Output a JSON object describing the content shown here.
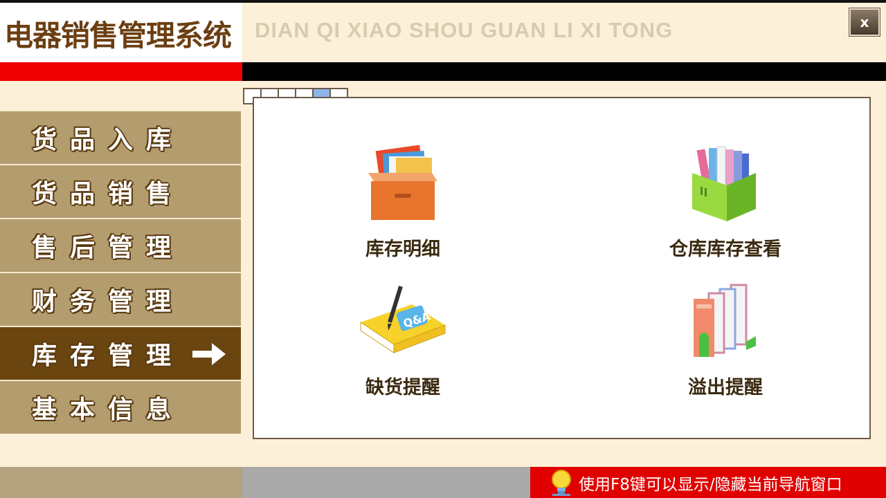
{
  "header": {
    "title": "电器销售管理系统",
    "pinyin": "DIAN QI XIAO SHOU GUAN LI XI TONG",
    "close_label": "x"
  },
  "sidebar": {
    "items": [
      {
        "label": "货品入库",
        "active": false
      },
      {
        "label": "货品销售",
        "active": false
      },
      {
        "label": "售后管理",
        "active": false
      },
      {
        "label": "财务管理",
        "active": false
      },
      {
        "label": "库存管理",
        "active": true
      },
      {
        "label": "基本信息",
        "active": false
      }
    ]
  },
  "pager": {
    "count": 6,
    "active_index": 4
  },
  "tiles": [
    {
      "label": "库存明细",
      "icon": "file-box-icon"
    },
    {
      "label": "仓库库存查看",
      "icon": "book-stand-icon"
    },
    {
      "label": "缺货提醒",
      "icon": "notebook-pen-icon"
    },
    {
      "label": "溢出提醒",
      "icon": "books-icon"
    }
  ],
  "status": {
    "hint": "使用F8键可以显示/隐藏当前导航窗口",
    "icon": "lightbulb-icon"
  },
  "colors": {
    "accent_red": "#ef0000",
    "sidebar_item": "#b39c6e",
    "sidebar_active": "#6a4510",
    "background": "#fdf0d8"
  }
}
